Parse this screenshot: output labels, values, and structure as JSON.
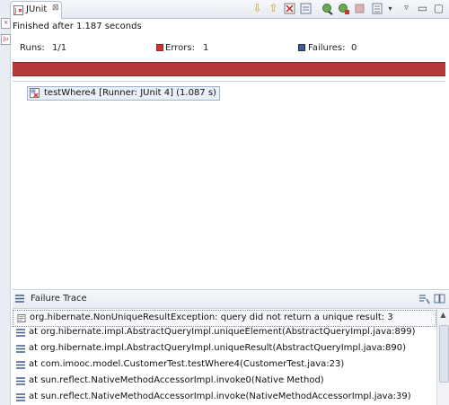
{
  "tab": {
    "label": "JUnit",
    "close": "⊠"
  },
  "status": {
    "finished": "Finished after 1.187 seconds"
  },
  "counts": {
    "runs_label": "Runs:",
    "runs_value": "1/1",
    "errors_label": "Errors:",
    "errors_value": "1",
    "failures_label": "Failures:",
    "failures_value": "0"
  },
  "progress": {
    "state": "failed",
    "fraction": 1.0,
    "color": "#b53a3a"
  },
  "tests": [
    {
      "label": "testWhere4 [Runner: JUnit 4] (1.087 s)"
    }
  ],
  "trace": {
    "title": "Failure Trace",
    "lines": [
      "org.hibernate.NonUniqueResultException: query did not return a unique result: 3",
      "at org.hibernate.impl.AbstractQueryImpl.uniqueElement(AbstractQueryImpl.java:899)",
      "at org.hibernate.impl.AbstractQueryImpl.uniqueResult(AbstractQueryImpl.java:890)",
      "at com.imooc.model.CustomerTest.testWhere4(CustomerTest.java:23)",
      "at sun.reflect.NativeMethodAccessorImpl.invoke0(Native Method)",
      "at sun.reflect.NativeMethodAccessorImpl.invoke(NativeMethodAccessorImpl.java:39)"
    ]
  },
  "icons": {
    "toolbar": [
      "next-failure-icon",
      "previous-failure-icon",
      "show-failures-only-icon",
      "scroll-lock-icon",
      "rerun-icon",
      "rerun-failed-first-icon",
      "stop-icon",
      "history-icon",
      "view-menu-icon",
      "minimize-icon",
      "maximize-icon"
    ]
  }
}
